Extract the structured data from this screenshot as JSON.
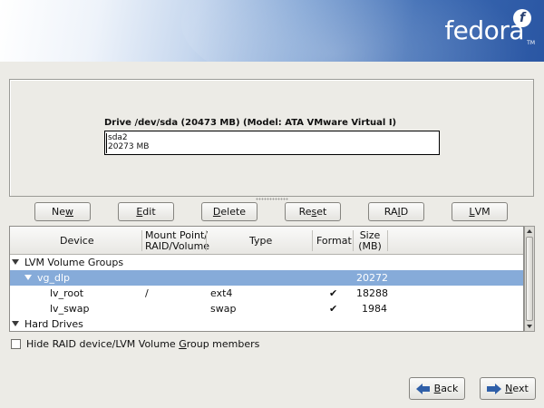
{
  "brand": {
    "logo_text": "fedora",
    "logo_mark": "f",
    "tm": "TM"
  },
  "drive": {
    "title": "Drive /dev/sda (20473 MB) (Model: ATA VMware Virtual I)",
    "partition_name": "sda2",
    "partition_size": "20273 MB"
  },
  "toolbar": {
    "new": {
      "pre": "Ne",
      "acc": "w",
      "post": ""
    },
    "edit": {
      "pre": "",
      "acc": "E",
      "post": "dit"
    },
    "delete": {
      "pre": "",
      "acc": "D",
      "post": "elete"
    },
    "reset": {
      "pre": "Re",
      "acc": "s",
      "post": "et"
    },
    "raid": {
      "pre": "RA",
      "acc": "I",
      "post": "D"
    },
    "lvm": {
      "pre": "",
      "acc": "L",
      "post": "VM"
    }
  },
  "table": {
    "headers": {
      "device": "Device",
      "mount_l1": "Mount Point/",
      "mount_l2": "RAID/Volume",
      "type": "Type",
      "format": "Format",
      "size_l1": "Size",
      "size_l2": "(MB)"
    },
    "rows": [
      {
        "device": "LVM Volume Groups",
        "mount": "",
        "type": "",
        "format": "",
        "size": ""
      },
      {
        "device": "vg_dlp",
        "mount": "",
        "type": "",
        "format": "",
        "size": "20272"
      },
      {
        "device": "lv_root",
        "mount": "/",
        "type": "ext4",
        "format": "✔",
        "size": "18288"
      },
      {
        "device": "lv_swap",
        "mount": "",
        "type": "swap",
        "format": "✔",
        "size": "1984"
      },
      {
        "device": "Hard Drives",
        "mount": "",
        "type": "",
        "format": "",
        "size": ""
      }
    ]
  },
  "hide_members": {
    "pre": "Hide RAID device/LVM Volume ",
    "acc": "G",
    "post": "roup members",
    "checked": false
  },
  "nav": {
    "back": {
      "pre": "",
      "acc": "B",
      "post": "ack"
    },
    "next": {
      "pre": "",
      "acc": "N",
      "post": "ext"
    }
  },
  "colors": {
    "selection": "#86abd9",
    "accent": "#2f5fa8"
  }
}
